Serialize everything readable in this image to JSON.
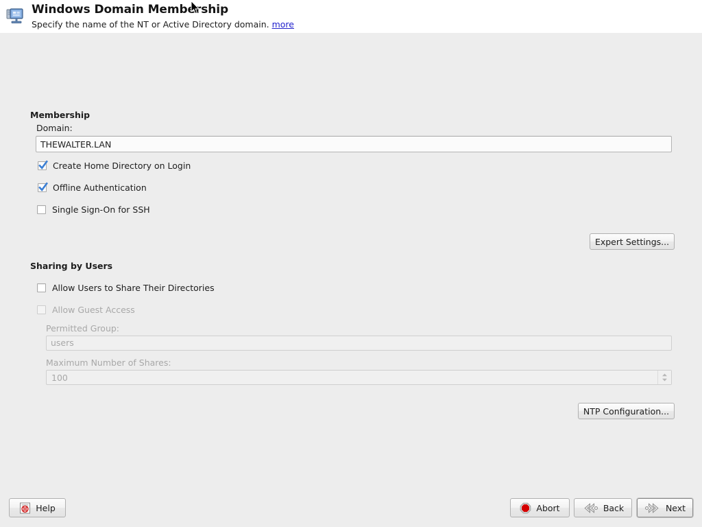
{
  "header": {
    "icon": "network-computer-icon",
    "title": "Windows Domain Membership",
    "subtitle": "Specify the name of the NT or Active Directory domain.",
    "more_link": "more"
  },
  "membership": {
    "group_title": "Membership",
    "domain_label": "Domain:",
    "domain_value": "THEWALTER.LAN",
    "checkboxes": [
      {
        "label": "Create Home Directory on Login",
        "checked": true,
        "enabled": true
      },
      {
        "label": "Offline Authentication",
        "checked": true,
        "enabled": true
      },
      {
        "label": "Single Sign-On for SSH",
        "checked": false,
        "enabled": true
      }
    ],
    "expert_button": "Expert Settings..."
  },
  "sharing": {
    "group_title": "Sharing by Users",
    "checkboxes": [
      {
        "label": "Allow Users to Share Their Directories",
        "checked": false,
        "enabled": true
      },
      {
        "label": "Allow Guest Access",
        "checked": false,
        "enabled": false
      }
    ],
    "permitted_group_label": "Permitted Group:",
    "permitted_group_value": "users",
    "max_shares_label": "Maximum Number of Shares:",
    "max_shares_value": "100",
    "ntp_button": "NTP Configuration..."
  },
  "footer": {
    "help": "Help",
    "abort": "Abort",
    "back": "Back",
    "next": "Next"
  },
  "colors": {
    "link": "#2222cc",
    "abort_red": "#d40000",
    "check_blue": "#3b7fd4",
    "body_bg": "#ededed",
    "header_bg": "#ffffff"
  }
}
